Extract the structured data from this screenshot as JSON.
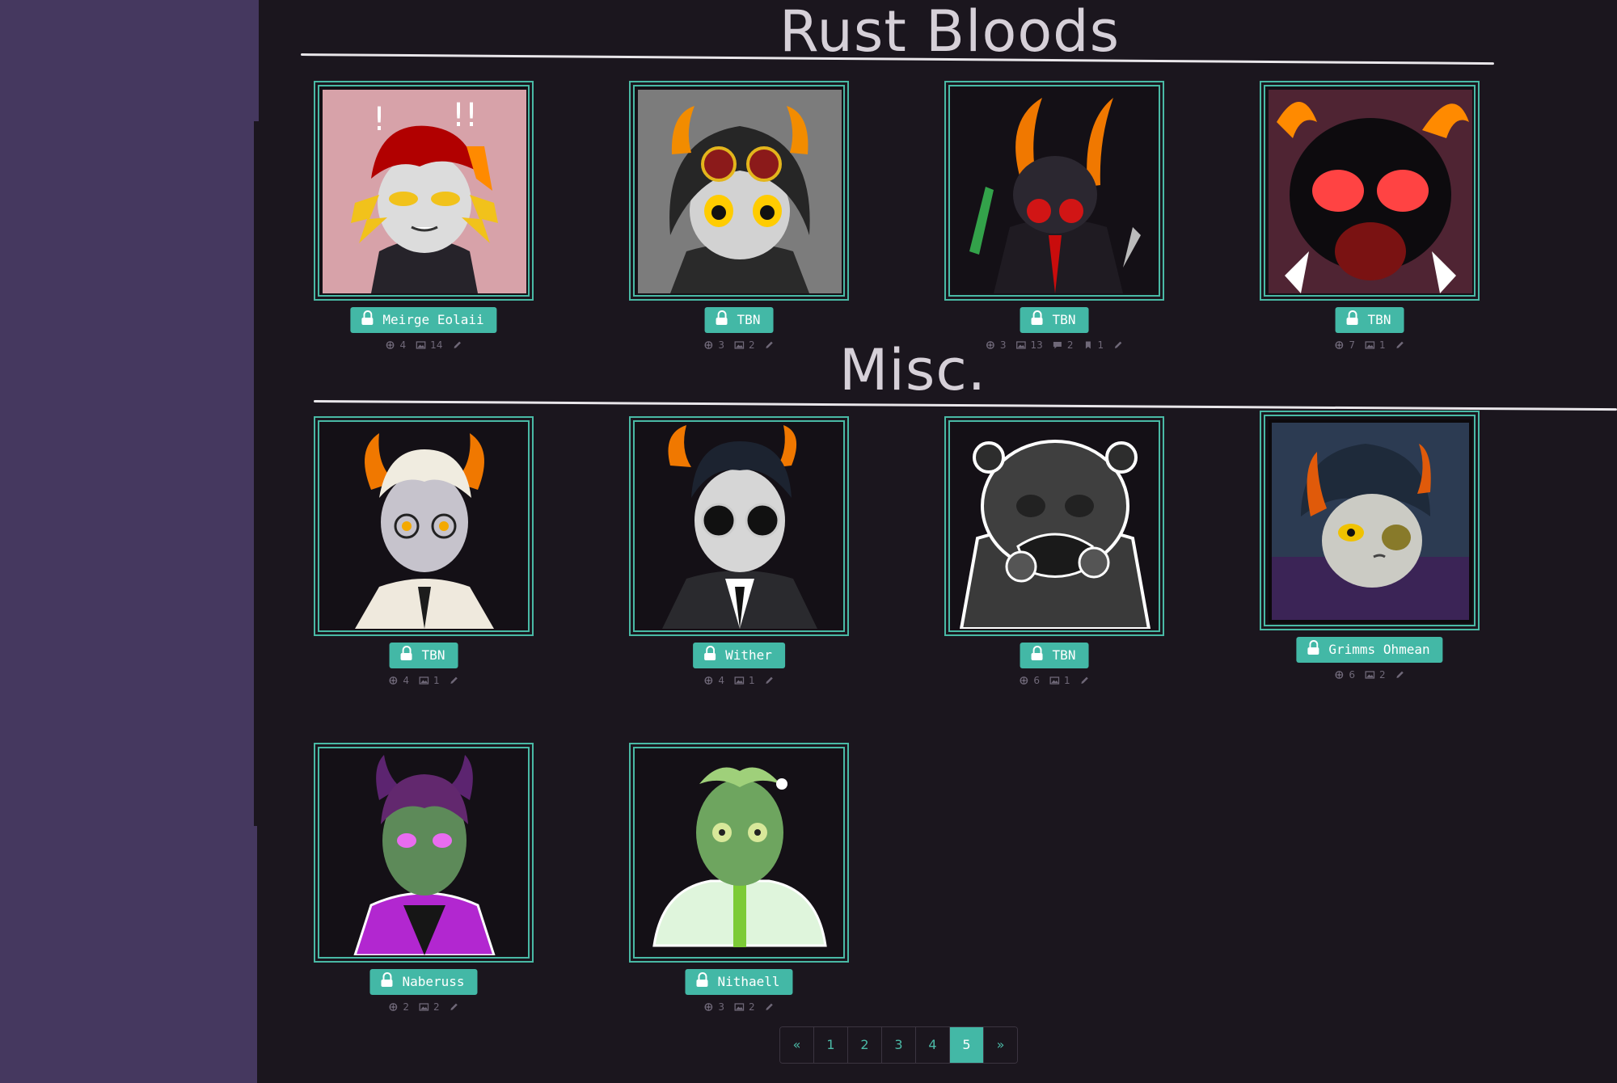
{
  "sections": {
    "rust": {
      "title": "Rust Bloods"
    },
    "misc": {
      "title": "Misc."
    }
  },
  "colors": {
    "accent": "#43b8a6",
    "background": "#1b161e",
    "sidebar": "#45385f"
  },
  "characters": [
    {
      "name": "Meirge Eolaii",
      "stats": [
        {
          "icon": "fan-icon",
          "value": "4"
        },
        {
          "icon": "image-icon",
          "value": "14"
        },
        {
          "icon": "pencil-icon",
          "value": ""
        }
      ]
    },
    {
      "name": "TBN",
      "stats": [
        {
          "icon": "fan-icon",
          "value": "3"
        },
        {
          "icon": "image-icon",
          "value": "2"
        },
        {
          "icon": "pencil-icon",
          "value": ""
        }
      ]
    },
    {
      "name": "TBN",
      "stats": [
        {
          "icon": "fan-icon",
          "value": "3"
        },
        {
          "icon": "image-icon",
          "value": "13"
        },
        {
          "icon": "comment-icon",
          "value": "2"
        },
        {
          "icon": "bookmark-icon",
          "value": "1"
        },
        {
          "icon": "pencil-icon",
          "value": ""
        }
      ]
    },
    {
      "name": "TBN",
      "stats": [
        {
          "icon": "fan-icon",
          "value": "7"
        },
        {
          "icon": "image-icon",
          "value": "1"
        },
        {
          "icon": "pencil-icon",
          "value": ""
        }
      ]
    },
    {
      "name": "TBN",
      "stats": [
        {
          "icon": "fan-icon",
          "value": "4"
        },
        {
          "icon": "image-icon",
          "value": "1"
        },
        {
          "icon": "pencil-icon",
          "value": ""
        }
      ]
    },
    {
      "name": "Wither",
      "stats": [
        {
          "icon": "fan-icon",
          "value": "4"
        },
        {
          "icon": "image-icon",
          "value": "1"
        },
        {
          "icon": "pencil-icon",
          "value": ""
        }
      ]
    },
    {
      "name": "TBN",
      "stats": [
        {
          "icon": "fan-icon",
          "value": "6"
        },
        {
          "icon": "image-icon",
          "value": "1"
        },
        {
          "icon": "pencil-icon",
          "value": ""
        }
      ]
    },
    {
      "name": "Grimms Ohmean",
      "stats": [
        {
          "icon": "fan-icon",
          "value": "6"
        },
        {
          "icon": "image-icon",
          "value": "2"
        },
        {
          "icon": "pencil-icon",
          "value": ""
        }
      ]
    },
    {
      "name": "Naberuss",
      "stats": [
        {
          "icon": "fan-icon",
          "value": "2"
        },
        {
          "icon": "image-icon",
          "value": "2"
        },
        {
          "icon": "pencil-icon",
          "value": ""
        }
      ]
    },
    {
      "name": "Nithaell",
      "stats": [
        {
          "icon": "fan-icon",
          "value": "3"
        },
        {
          "icon": "image-icon",
          "value": "2"
        },
        {
          "icon": "pencil-icon",
          "value": ""
        }
      ]
    }
  ],
  "pagination": {
    "prev": "«",
    "pages": [
      "1",
      "2",
      "3",
      "4",
      "5"
    ],
    "active": "5",
    "next": "»"
  }
}
